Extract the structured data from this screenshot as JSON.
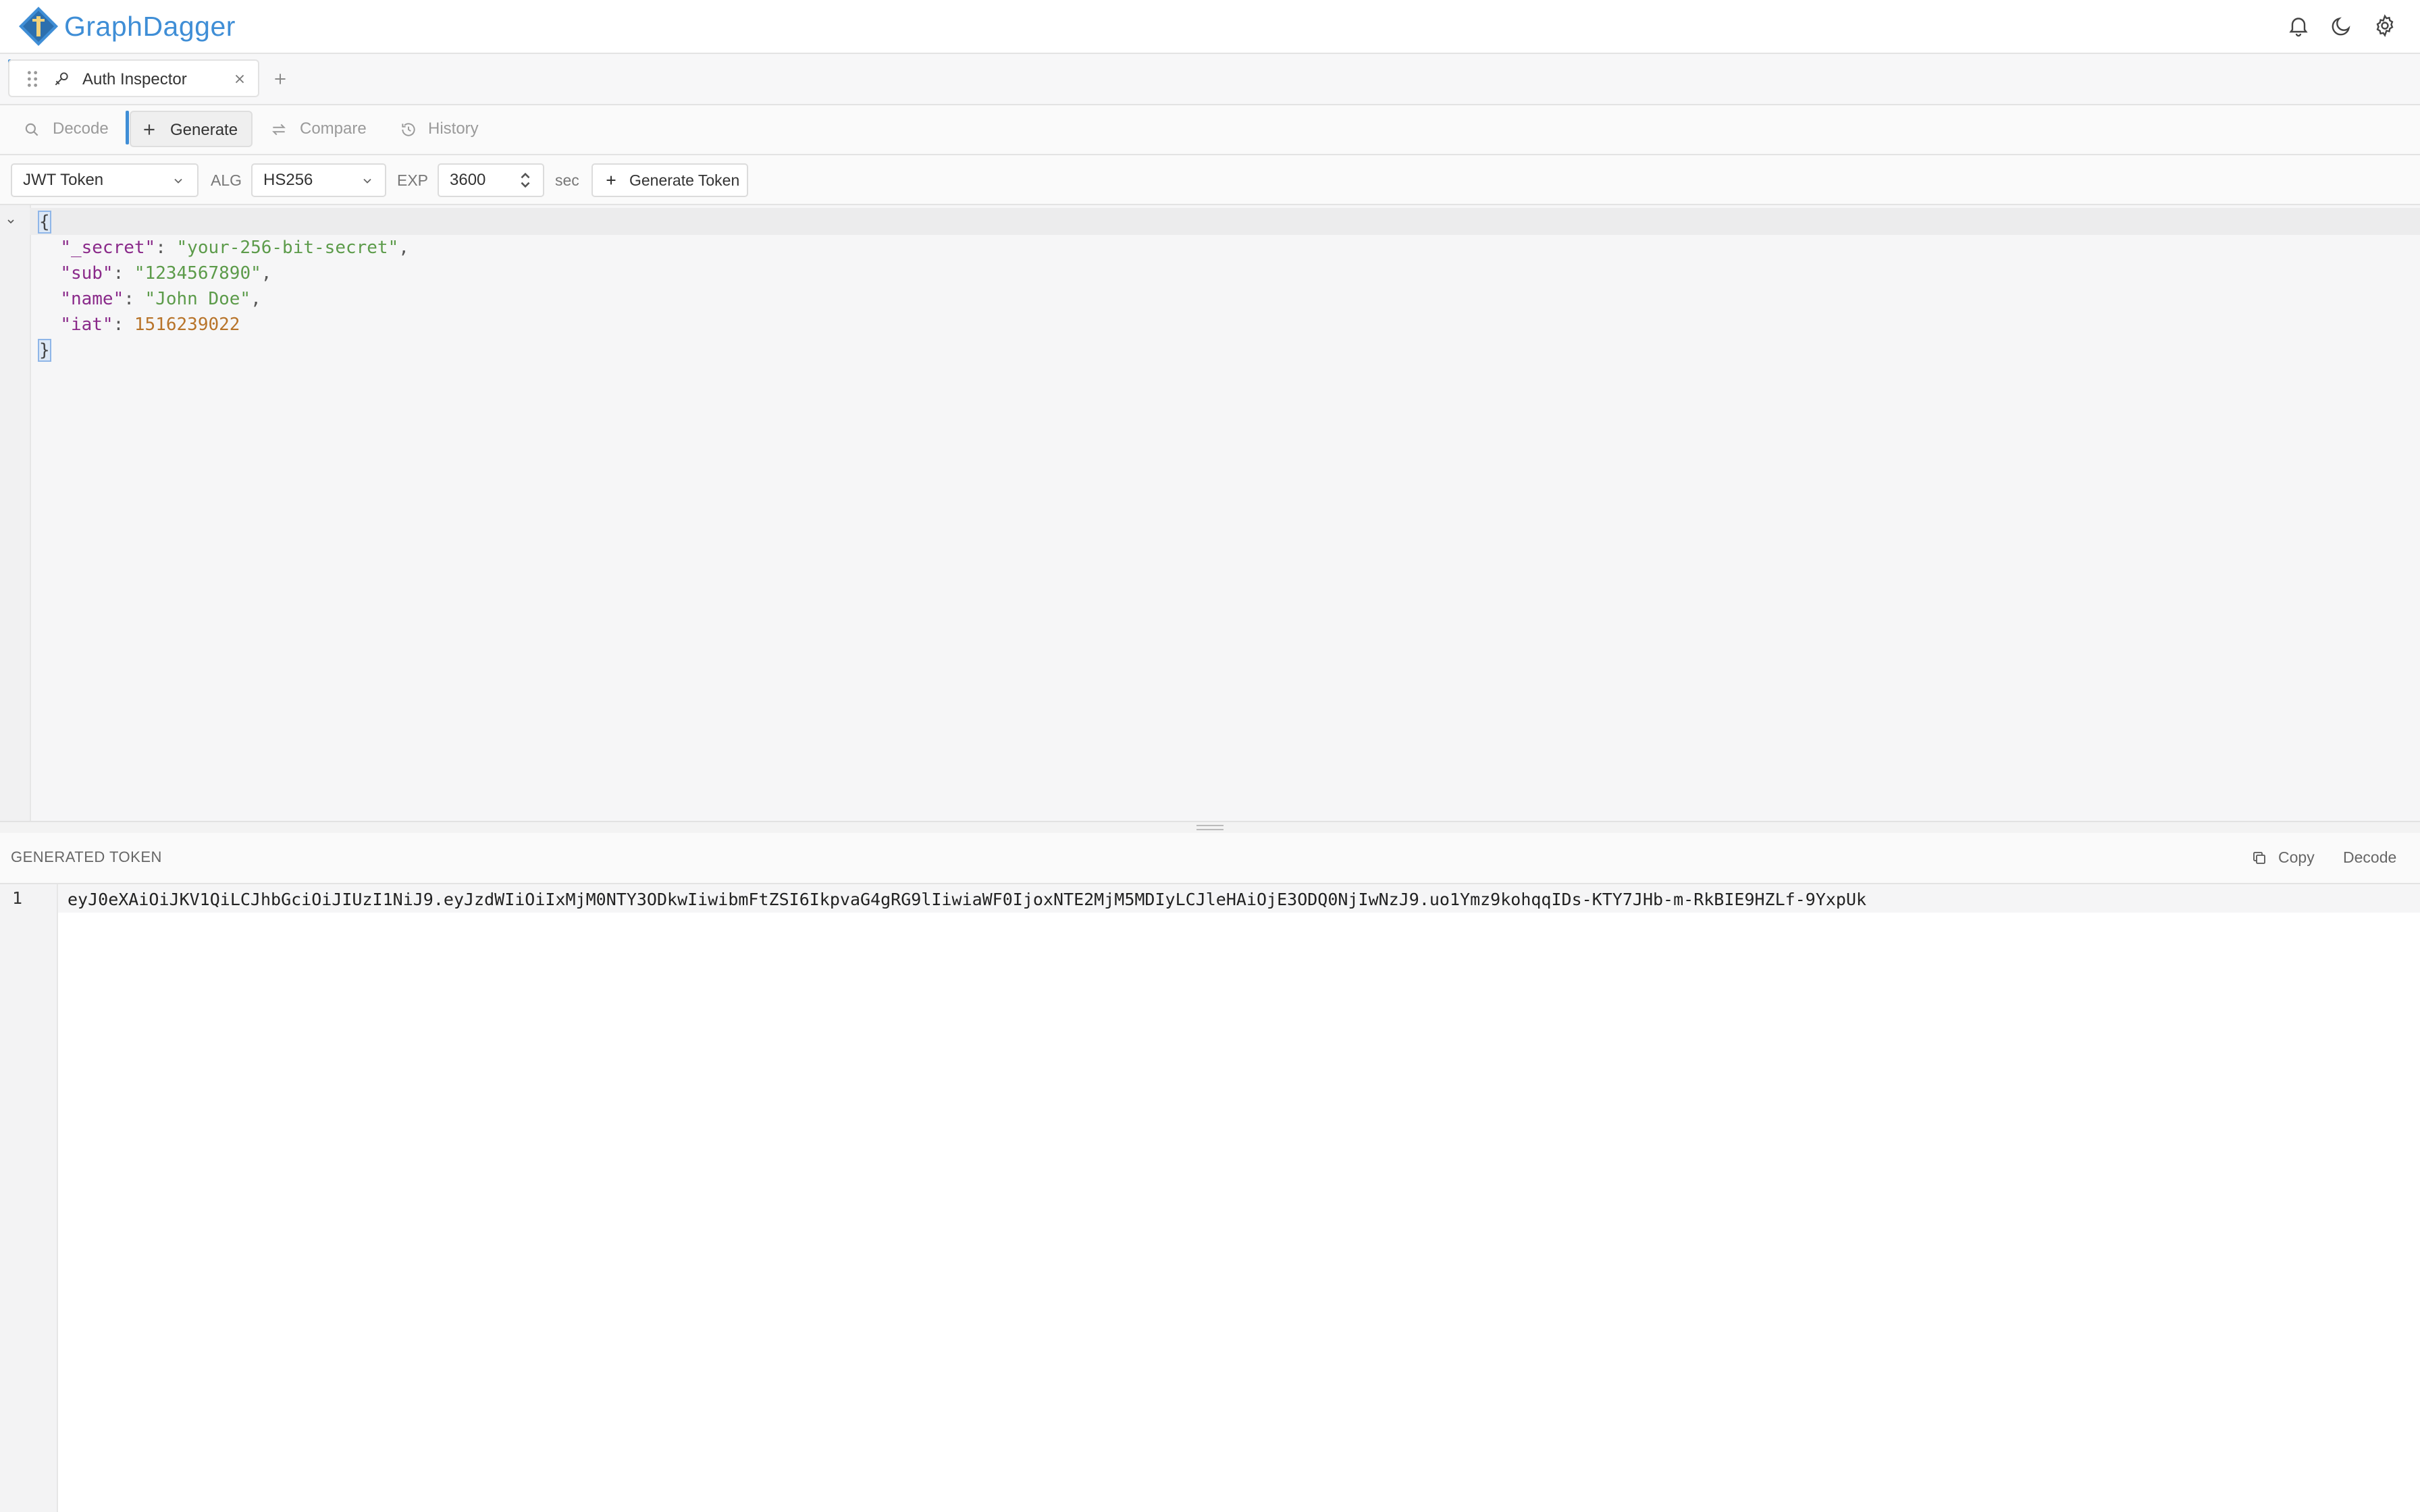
{
  "app": {
    "title": "GraphDagger",
    "accent_color": "#3f8ed6",
    "header_icons": [
      "bell-icon",
      "moon-icon",
      "gear-icon"
    ]
  },
  "tabs": [
    {
      "label": "Auth Inspector",
      "icon": "key-icon",
      "active": true
    }
  ],
  "modes": [
    {
      "label": "Decode",
      "icon": "search-icon",
      "active": false
    },
    {
      "label": "Generate",
      "icon": "plus-icon",
      "active": true
    },
    {
      "label": "Compare",
      "icon": "swap-icon",
      "active": false
    },
    {
      "label": "History",
      "icon": "history-icon",
      "active": false
    }
  ],
  "options": {
    "token_type": "JWT Token",
    "alg_label": "ALG",
    "alg_value": "HS256",
    "exp_label": "EXP",
    "exp_value": "3600",
    "exp_unit": "sec",
    "generate_button": "Generate Token"
  },
  "editor": {
    "open_brace": "{",
    "close_brace": "}",
    "fields": [
      {
        "key": "\"_secret\"",
        "value": "\"your-256-bit-secret\"",
        "type": "string"
      },
      {
        "key": "\"sub\"",
        "value": "\"1234567890\"",
        "type": "string"
      },
      {
        "key": "\"name\"",
        "value": "\"John Doe\"",
        "type": "string"
      },
      {
        "key": "\"iat\"",
        "value": "1516239022",
        "type": "number"
      }
    ]
  },
  "output": {
    "title": "GENERATED TOKEN",
    "copy_label": "Copy",
    "decode_label": "Decode",
    "line_number": "1",
    "token": "eyJ0eXAiOiJKV1QiLCJhbGciOiJIUzI1NiJ9.eyJzdWIiOiIxMjM0NTY3ODkwIiwibmFtZSI6IkpvaG4gRG9lIiwiaWF0IjoxNTE2MjM5MDIyLCJleHAiOjE3ODQ0NjIwNzJ9.uo1Ymz9kohqqIDs-KTY7JHb-m-RkBIE9HZLf-9YxpUk"
  }
}
